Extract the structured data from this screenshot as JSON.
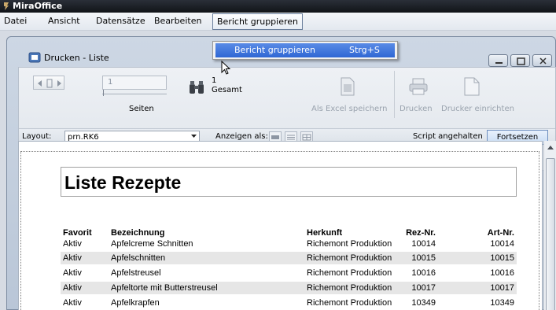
{
  "app": {
    "title": "MiraOffice"
  },
  "menubar": {
    "items": [
      "Datei",
      "Ansicht",
      "Datensätze",
      "Bearbeiten",
      "Bericht gruppieren"
    ]
  },
  "dropdown": {
    "label": "Bericht gruppieren",
    "shortcut": "Strg+S"
  },
  "window": {
    "title": "Drucken - Liste"
  },
  "toolbar": {
    "page_value": "1",
    "pages_label": "Seiten",
    "count_value": "1",
    "count_label": "Gesamt",
    "excel_label": "Als Excel speichern",
    "print_label": "Drucken",
    "printer_setup_label": "Drucker einrichten"
  },
  "layout_bar": {
    "layout_label": "Layout:",
    "layout_value": "prn.RK6",
    "view_label": "Anzeigen als:",
    "script_status": "Script angehalten",
    "continue_label": "Fortsetzen"
  },
  "report": {
    "title": "Liste Rezepte",
    "columns": [
      "Favorit",
      "Bezeichnung",
      "Herkunft",
      "Rez-Nr.",
      "Art-Nr."
    ],
    "rows": [
      [
        "Aktiv",
        "Apfelcreme Schnitten",
        "Richemont Produktion",
        "10014",
        "10014"
      ],
      [
        "Aktiv",
        "Apfelschnitten",
        "Richemont Produktion",
        "10015",
        "10015"
      ],
      [
        "Aktiv",
        "Apfelstreusel",
        "Richemont Produktion",
        "10016",
        "10016"
      ],
      [
        "Aktiv",
        "Apfeltorte mit Butterstreusel",
        "Richemont Produktion",
        "10017",
        "10017"
      ],
      [
        "Aktiv",
        "Apfelkrapfen",
        "Richemont Produktion",
        "10349",
        "10349"
      ]
    ]
  },
  "colors": {
    "menu_highlight": "#3a72dd",
    "titlebar": "#1a1d23"
  }
}
